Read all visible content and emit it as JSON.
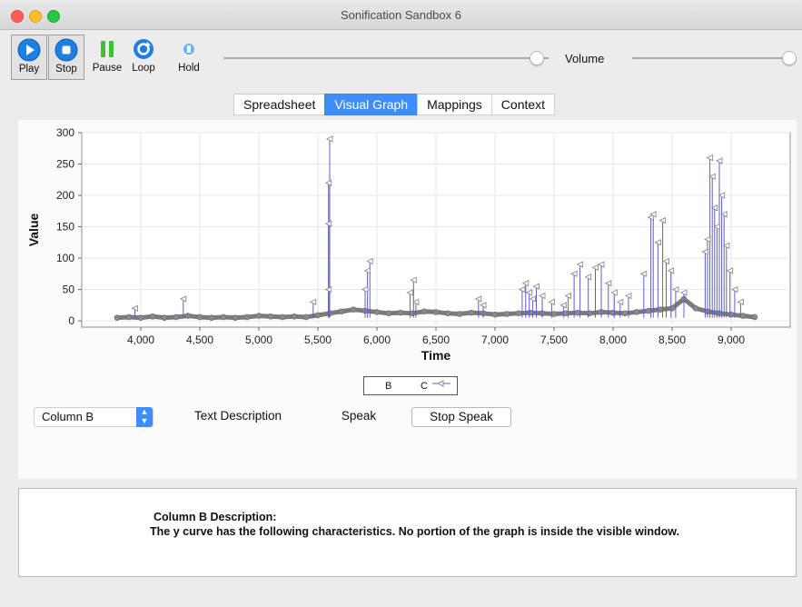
{
  "window": {
    "title": "Sonification Sandbox 6"
  },
  "toolbar": {
    "play": "Play",
    "stop": "Stop",
    "pause": "Pause",
    "loop": "Loop",
    "hold": "Hold",
    "volume_label": "Volume",
    "progress": 0.96,
    "volume": 0.98
  },
  "tabs": [
    {
      "label": "Spreadsheet",
      "active": false
    },
    {
      "label": "Visual Graph",
      "active": true
    },
    {
      "label": "Mappings",
      "active": false
    },
    {
      "label": "Context",
      "active": false
    }
  ],
  "chart_data": {
    "type": "line",
    "xlabel": "Time",
    "ylabel": "Value",
    "xlim": [
      3500,
      9500
    ],
    "ylim": [
      -10,
      300
    ],
    "x_ticks": [
      4000,
      4500,
      5000,
      5500,
      6000,
      6500,
      7000,
      7500,
      8000,
      8500,
      9000
    ],
    "x_tick_labels": [
      "4,000",
      "4,500",
      "5,000",
      "5,500",
      "6,000",
      "6,500",
      "7,000",
      "7,500",
      "8,000",
      "8,500",
      "9,000"
    ],
    "y_ticks": [
      0,
      50,
      100,
      150,
      200,
      250,
      300
    ],
    "y_tick_labels": [
      "0",
      "50",
      "100",
      "150",
      "200",
      "250",
      "300"
    ],
    "grid": true,
    "legend_position": "bottom-center",
    "colors": {
      "B": "#7a7a7a",
      "C": "#5d5fc4",
      "C_marker": "#8a8a8a"
    },
    "series": [
      {
        "name": "B",
        "x": [
          3800,
          3900,
          4000,
          4100,
          4200,
          4300,
          4400,
          4500,
          4600,
          4700,
          4800,
          4900,
          5000,
          5100,
          5200,
          5300,
          5400,
          5500,
          5600,
          5700,
          5800,
          5900,
          6000,
          6100,
          6200,
          6300,
          6400,
          6500,
          6600,
          6700,
          6800,
          6900,
          7000,
          7100,
          7200,
          7300,
          7400,
          7500,
          7600,
          7700,
          7800,
          7900,
          8000,
          8100,
          8200,
          8300,
          8400,
          8500,
          8600,
          8700,
          8800,
          8900,
          9000,
          9100,
          9200
        ],
        "values": [
          5,
          6,
          5,
          7,
          5,
          6,
          8,
          6,
          5,
          6,
          5,
          6,
          8,
          7,
          6,
          7,
          6,
          9,
          12,
          15,
          18,
          16,
          14,
          12,
          13,
          12,
          15,
          14,
          12,
          11,
          13,
          12,
          10,
          11,
          12,
          13,
          12,
          11,
          12,
          13,
          12,
          14,
          13,
          12,
          14,
          16,
          18,
          20,
          35,
          20,
          15,
          12,
          10,
          8,
          6
        ]
      },
      {
        "name": "C",
        "x": [
          3950,
          4360,
          5460,
          5590,
          5590,
          5590,
          5600,
          5900,
          5920,
          5940,
          6280,
          6310,
          6330,
          6860,
          6900,
          7230,
          7260,
          7290,
          7320,
          7350,
          7400,
          7480,
          7580,
          7620,
          7670,
          7720,
          7790,
          7850,
          7900,
          7960,
          8010,
          8060,
          8130,
          8260,
          8320,
          8340,
          8380,
          8420,
          8450,
          8490,
          8530,
          8600,
          8780,
          8800,
          8820,
          8840,
          8860,
          8880,
          8900,
          8920,
          8940,
          8960,
          8990,
          9030,
          9080
        ],
        "values": [
          20,
          35,
          30,
          50,
          155,
          220,
          290,
          50,
          80,
          95,
          45,
          65,
          30,
          35,
          25,
          50,
          60,
          45,
          35,
          55,
          40,
          30,
          25,
          40,
          75,
          90,
          70,
          85,
          90,
          60,
          45,
          30,
          40,
          75,
          165,
          170,
          125,
          160,
          95,
          80,
          50,
          45,
          110,
          130,
          260,
          230,
          180,
          150,
          255,
          200,
          170,
          120,
          80,
          50,
          30
        ]
      }
    ]
  },
  "legend": {
    "b_label": "B",
    "c_label": "C"
  },
  "controls": {
    "column_select": "Column B",
    "text_description": "Text Description",
    "speak": "Speak",
    "stop_speak": "Stop Speak"
  },
  "description": {
    "title": "Column B Description:",
    "text": "The y curve has the following characteristics.  No portion of the graph is inside the visible window."
  }
}
